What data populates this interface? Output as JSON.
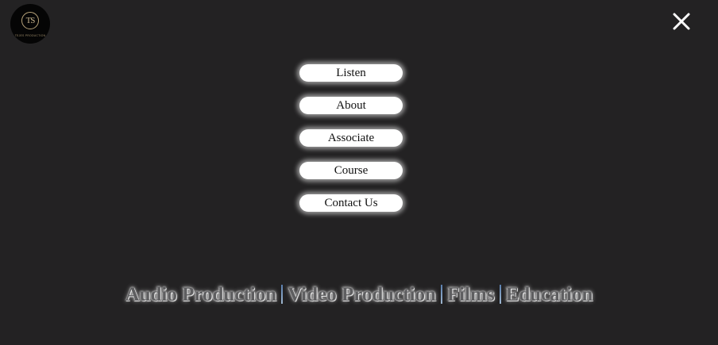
{
  "logo": {
    "monogram": "TS",
    "subtitle": "TEJES PRODUCTION"
  },
  "close": {
    "icon": "close-icon"
  },
  "menu": {
    "items": [
      {
        "label": "Listen"
      },
      {
        "label": "About"
      },
      {
        "label": "Associate"
      },
      {
        "label": "Course"
      },
      {
        "label": "Contact Us"
      }
    ]
  },
  "tagline": {
    "items": [
      "Audio Production",
      "Video Production",
      "Films",
      "Education"
    ],
    "separator": "|"
  },
  "colors": {
    "background": "#232223",
    "button": "#ffffff",
    "tagline_text": "#5e5e60",
    "separator": "#7c9bc0"
  }
}
